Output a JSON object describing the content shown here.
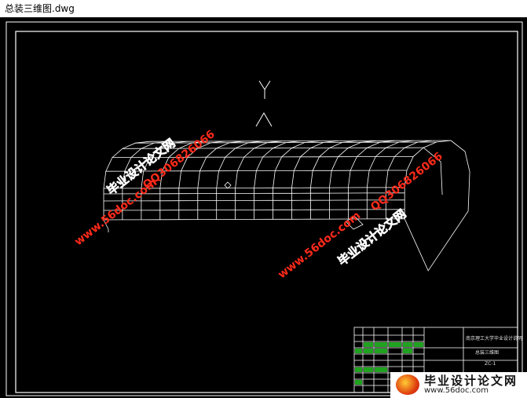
{
  "window": {
    "title": "总装三维图.dwg"
  },
  "drawing": {
    "axis_label": "Y",
    "title_block": {
      "school": "南京理工大学毕业设计说明",
      "drawing_name": "总装三维图",
      "code": "ZC-1"
    }
  },
  "watermarks": {
    "left_site": "毕业设计论文网",
    "left_url": "www.56doc.com",
    "left_qq": "QQ306826066",
    "right_site": "毕业设计论文网",
    "right_url": "www.56doc.com",
    "right_qq": "QQ306826066"
  },
  "footer": {
    "title": "毕业设计论文网",
    "url": "www.56doc.com"
  },
  "colors": {
    "background": "#000000",
    "line": "#ffffff",
    "watermark": "#ff2a1a",
    "titleblock_green": "#1fa31f"
  }
}
